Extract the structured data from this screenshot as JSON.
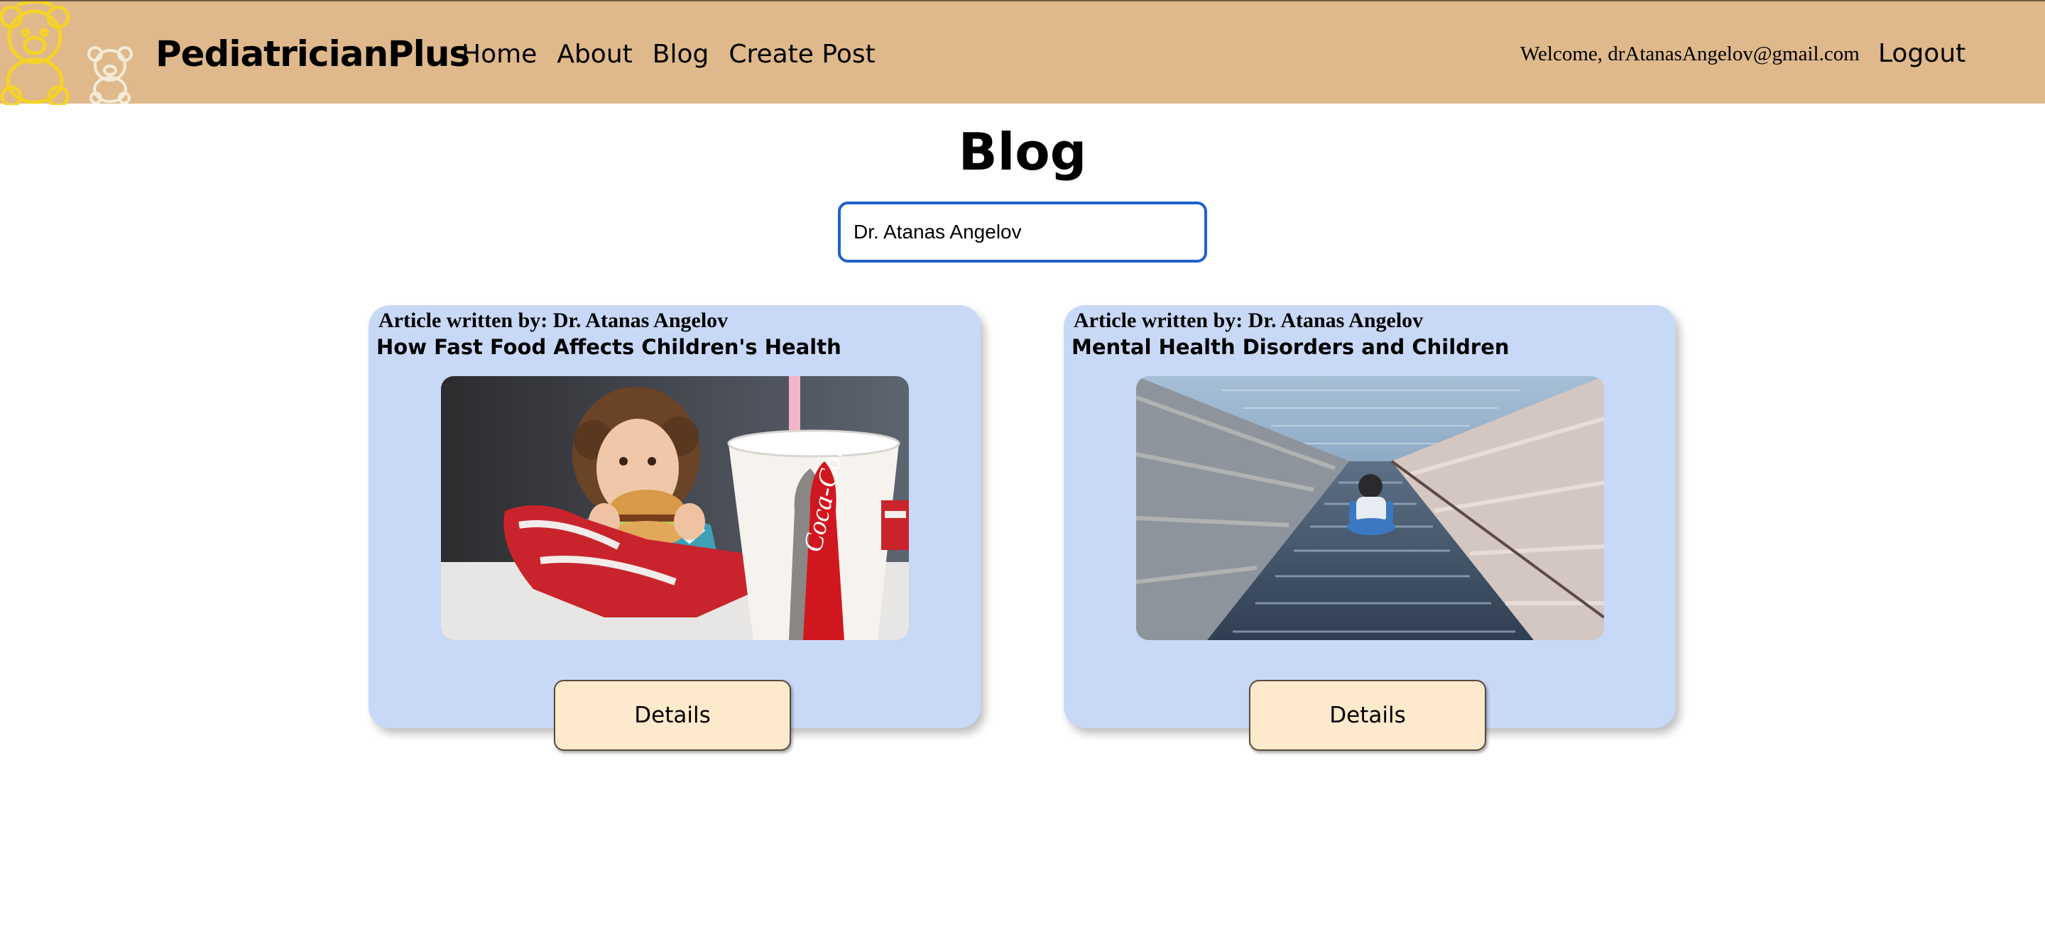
{
  "header": {
    "brand": "PediatricianPlus",
    "nav": [
      "Home",
      "About",
      "Blog",
      "Create Post"
    ],
    "welcome": "Welcome, drAtanasAngelov@gmail.com",
    "logout": "Logout"
  },
  "main": {
    "title": "Blog",
    "search": {
      "value": "Dr. Atanas Angelov"
    },
    "posts": [
      {
        "author": "Article written by: Dr. Atanas Angelov",
        "title": "How Fast Food Affects Children's Health",
        "image": "child-eating-burger-photo",
        "details_label": "Details"
      },
      {
        "author": "Article written by: Dr. Atanas Angelov",
        "title": "Mental Health Disorders and Children",
        "image": "child-on-stairs-photo",
        "details_label": "Details"
      }
    ]
  },
  "colors": {
    "header_bg": "#dfb98b",
    "card_bg": "#c8d9f7",
    "button_bg": "#fde9cb",
    "search_border": "#1f62c8"
  }
}
